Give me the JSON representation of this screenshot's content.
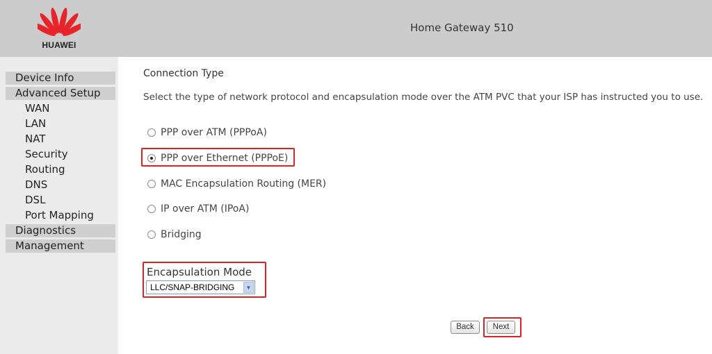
{
  "header": {
    "brand": "HUAWEI",
    "title": "Home Gateway 510",
    "logo_icon": "huawei-petal-logo-icon"
  },
  "sidebar": {
    "items": [
      {
        "label": "Device Info",
        "level": "top"
      },
      {
        "label": "Advanced Setup",
        "level": "top"
      },
      {
        "label": "WAN",
        "level": "sub"
      },
      {
        "label": "LAN",
        "level": "sub"
      },
      {
        "label": "NAT",
        "level": "sub"
      },
      {
        "label": "Security",
        "level": "sub"
      },
      {
        "label": "Routing",
        "level": "sub"
      },
      {
        "label": "DNS",
        "level": "sub"
      },
      {
        "label": "DSL",
        "level": "sub"
      },
      {
        "label": "Port Mapping",
        "level": "sub"
      },
      {
        "label": "Diagnostics",
        "level": "top"
      },
      {
        "label": "Management",
        "level": "top"
      }
    ]
  },
  "main": {
    "title": "Connection Type",
    "description": "Select the type of network protocol and encapsulation mode over the ATM PVC that your ISP has instructed you to use.",
    "options": [
      {
        "label": "PPP over ATM (PPPoA)",
        "checked": false
      },
      {
        "label": "PPP over Ethernet (PPPoE)",
        "checked": true
      },
      {
        "label": "MAC Encapsulation Routing (MER)",
        "checked": false
      },
      {
        "label": "IP over ATM (IPoA)",
        "checked": false
      },
      {
        "label": "Bridging",
        "checked": false
      }
    ],
    "encapsulation": {
      "label": "Encapsulation Mode",
      "selected": "LLC/SNAP-BRIDGING"
    },
    "buttons": {
      "back": "Back",
      "next": "Next"
    }
  },
  "colors": {
    "header_bg": "#cccccc",
    "sidebar_bg": "#ebebeb",
    "nav_top_bg": "#cfcfcf",
    "highlight": "#e02020",
    "logo_red": "#e8242b"
  }
}
